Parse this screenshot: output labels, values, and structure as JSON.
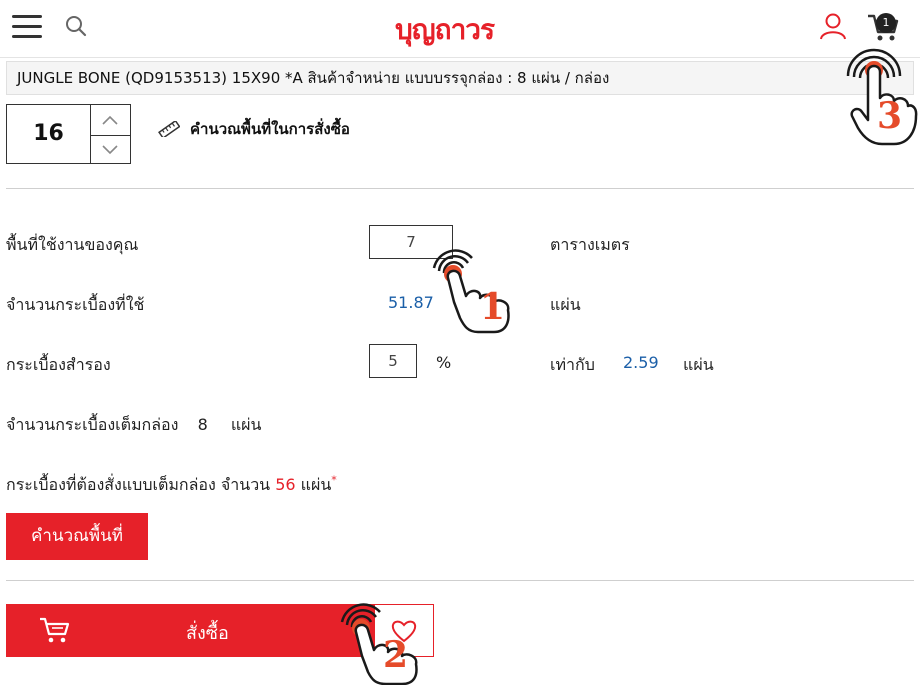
{
  "header": {
    "logo_text": "บุญถาวร",
    "cart_count": "1",
    "icons": [
      "hamburger-menu-icon",
      "search-icon",
      "user-icon",
      "cart-icon"
    ],
    "accent": "#e62129"
  },
  "product": {
    "name": "JUNGLE BONE (QD9153513) 15X90 *A สินค้าจำหน่าย แบบบรรจุกล่อง : 8 แผ่น / กล่อง"
  },
  "quantity": {
    "value": "16"
  },
  "calculator_link": {
    "label": "คำนวณพื้นที่ในการสั่งซื้อ"
  },
  "area": {
    "label": "พื้นที่ใช้งานของคุณ",
    "value": "7",
    "unit": "ตารางเมตร"
  },
  "tiles_used": {
    "label": "จำนวนกระเบื้องที่ใช้",
    "value": "51.87",
    "unit": "แผ่น"
  },
  "spare": {
    "label": "กระเบื้องสำรอง",
    "value": "5",
    "percent_sign": "%",
    "equals_label": "เท่ากับ",
    "equals_value": "2.59",
    "unit": "แผ่น"
  },
  "per_box": {
    "label": "จำนวนกระเบื้องเต็มกล่อง",
    "value": "8",
    "unit": "แผ่น"
  },
  "order_total": {
    "label": "กระเบื้องที่ต้องสั่งแบบเต็มกล่อง จำนวน",
    "value": "56",
    "unit": "แผ่น",
    "asterisk": "*"
  },
  "buttons": {
    "calculate": "คำนวณพื้นที่",
    "order": "สั่งซื้อ"
  },
  "steps": [
    "1",
    "2",
    "3"
  ]
}
